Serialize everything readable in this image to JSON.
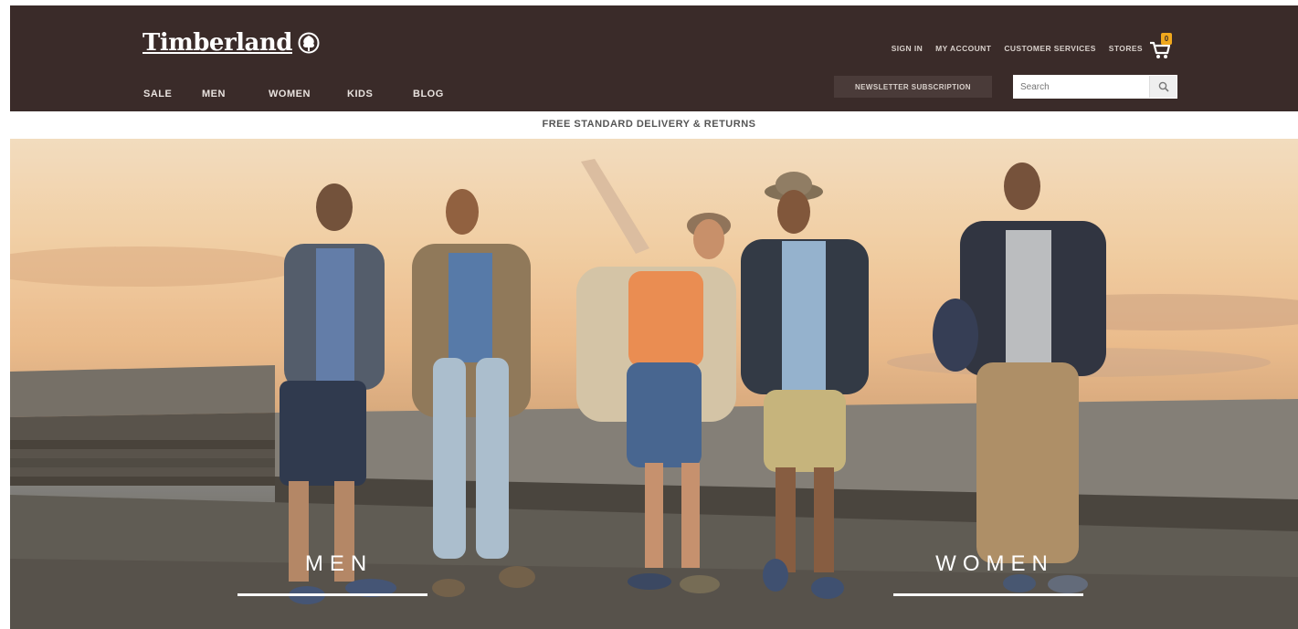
{
  "brand": {
    "name": "Timberland",
    "logo_icon": "tree-icon"
  },
  "main_nav": [
    {
      "label": "SALE"
    },
    {
      "label": "MEN"
    },
    {
      "label": "WOMEN"
    },
    {
      "label": "KIDS"
    },
    {
      "label": "BLOG"
    }
  ],
  "utility_nav": [
    {
      "label": "SIGN IN"
    },
    {
      "label": "MY ACCOUNT"
    },
    {
      "label": "CUSTOMER SERVICES"
    },
    {
      "label": "STORES"
    }
  ],
  "cart": {
    "icon": "cart-icon",
    "count": "0"
  },
  "newsletter": {
    "label": "NEWSLETTER SUBSCRIPTION"
  },
  "search": {
    "placeholder": "Search",
    "icon": "search-icon"
  },
  "promo": {
    "text": "FREE STANDARD DELIVERY & RETURNS"
  },
  "hero": {
    "ctas": [
      {
        "label": "MEN"
      },
      {
        "label": "WOMEN"
      }
    ]
  },
  "colors": {
    "header_bg": "#3a2b29",
    "cart_badge": "#f0a81d",
    "text_light": "#ffffff"
  }
}
